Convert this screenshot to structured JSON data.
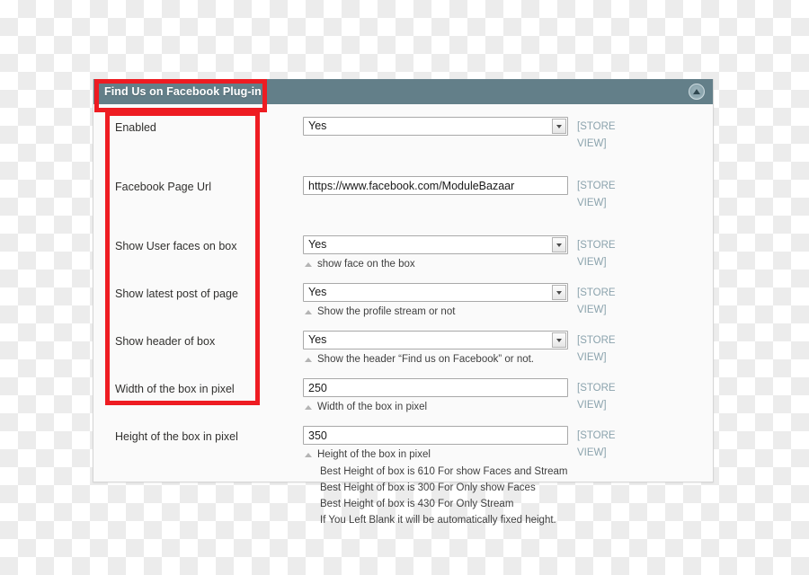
{
  "panel": {
    "title": "Find Us on Facebook Plug-in",
    "collapse_icon": "triangle-up-icon",
    "header_color": "#637f89",
    "annotation_color": "#ee1c22"
  },
  "scope_label": "[STORE VIEW]",
  "rows": [
    {
      "label": "Enabled",
      "control": "select",
      "value": "Yes",
      "comment": "",
      "scope": "[STORE VIEW]"
    },
    {
      "label": "Facebook Page Url",
      "control": "text",
      "value": "https://www.facebook.com/ModuleBazaar",
      "comment": "",
      "scope": "[STORE VIEW]"
    },
    {
      "label": "Show User faces on box",
      "control": "select",
      "value": "Yes",
      "comment": "show face on the box",
      "scope": "[STORE VIEW]"
    },
    {
      "label": "Show latest post of page",
      "control": "select",
      "value": "Yes",
      "comment": "Show the profile stream or not",
      "scope": "[STORE VIEW]"
    },
    {
      "label": "Show header of box",
      "control": "select",
      "value": "Yes",
      "comment": "Show the header “Find us on Facebook” or not.",
      "scope": "[STORE VIEW]"
    },
    {
      "label": "Width of the box in pixel",
      "control": "text",
      "value": "250",
      "comment": "Width of the box in pixel",
      "scope": "[STORE VIEW]"
    },
    {
      "label": "Height of the box in pixel",
      "control": "text",
      "value": "350",
      "comment": "Height of the box in pixel",
      "scope": "[STORE VIEW]",
      "notes": [
        "Best Height of box is 610 For show Faces and Stream",
        "Best Height of box is 300 For Only show Faces",
        "Best Height of box is 430 For Only Stream",
        "If You Left Blank it will be automatically fixed height."
      ]
    }
  ]
}
